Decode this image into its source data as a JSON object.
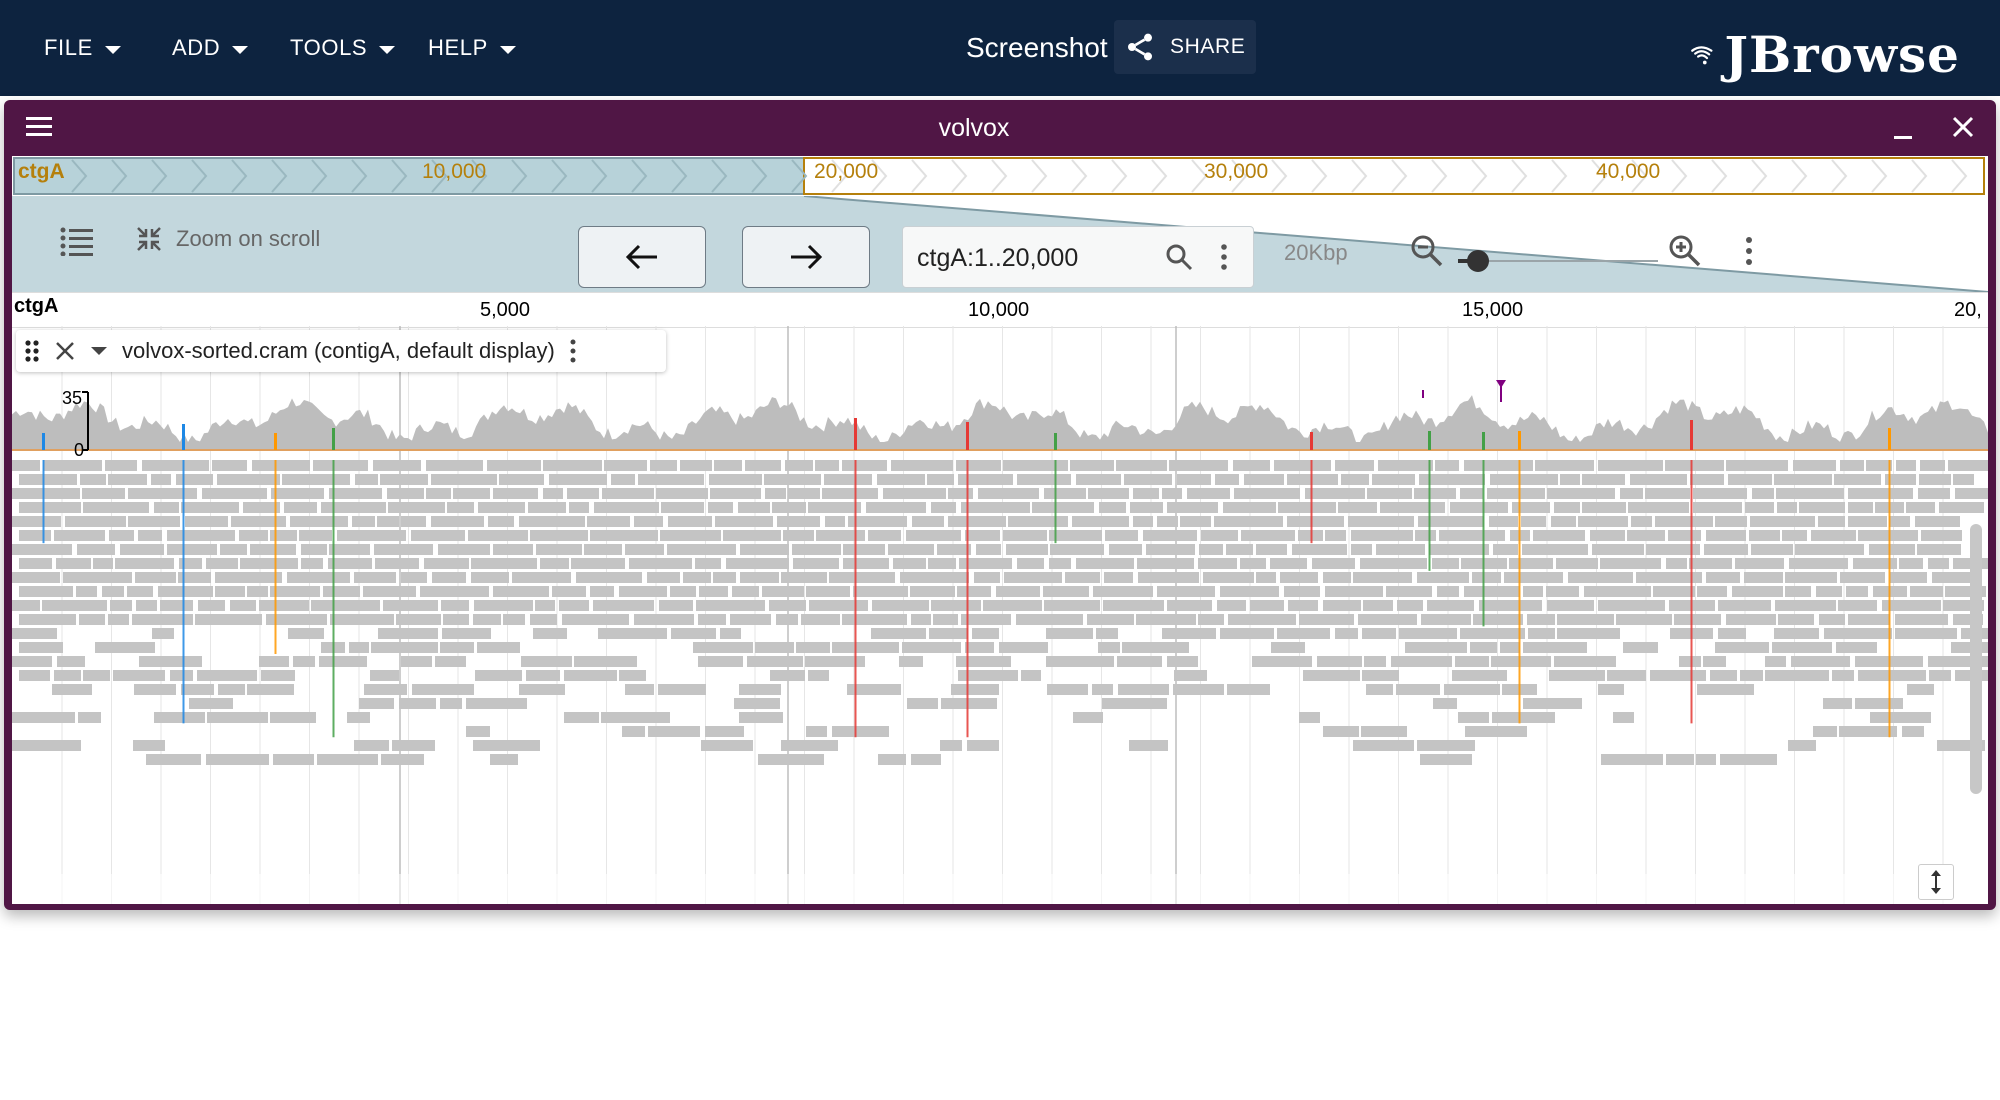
{
  "app": {
    "menus": [
      {
        "label": "FILE"
      },
      {
        "label": "ADD"
      },
      {
        "label": "TOOLS"
      },
      {
        "label": "HELP"
      }
    ],
    "session_name": "Screenshot",
    "share_label": "SHARE",
    "logo_text": "JBrowse"
  },
  "view": {
    "name": "volvox",
    "overview": {
      "ref_name": "ctgA",
      "labels": [
        "10,000",
        "20,000",
        "30,000",
        "40,000"
      ],
      "selected_fill": "#b7d2d9",
      "border_color": "#b5800c"
    },
    "toolbar": {
      "zoom_on_scroll_label": "Zoom on scroll",
      "location_value": "ctgA:1..20,000",
      "bp_per_view_label": "20Kbp",
      "zoom_level": 0.1
    },
    "ruler": {
      "ref_name": "ctgA",
      "labels": [
        "5,000",
        "10,000",
        "15,000",
        "20,"
      ]
    },
    "track": {
      "name": "volvox-sorted.cram (contigA, default display)",
      "coverage_axis": {
        "max": "35",
        "min": "0"
      },
      "colors": {
        "coverage": "#bdbdbd",
        "reads": "#c4c4c4",
        "mismatch_A": "#e53935",
        "mismatch_C": "#1e88e5",
        "mismatch_G": "#ff9800",
        "mismatch_T": "#43a047",
        "insertion": "#800080"
      }
    }
  }
}
